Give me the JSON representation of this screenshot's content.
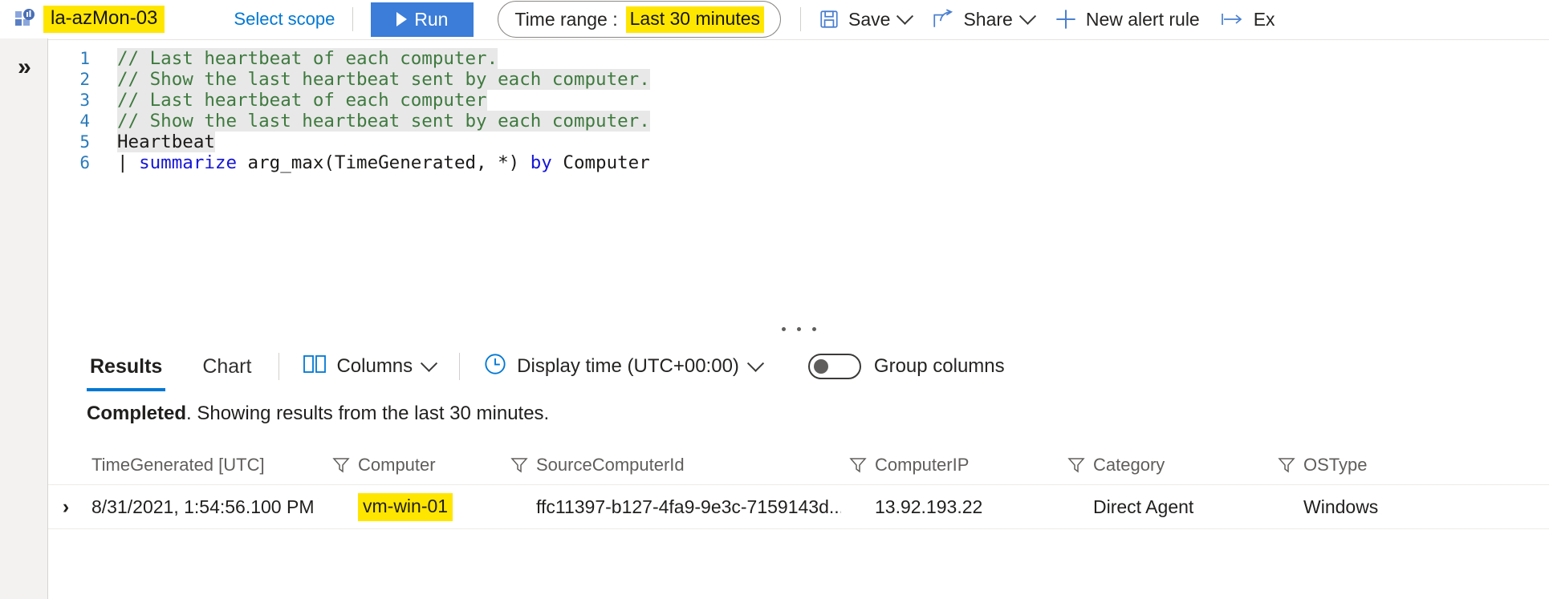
{
  "toolbar": {
    "workspace_icon": "log-analytics-icon",
    "workspace_name": "la-azMon-03",
    "select_scope_label": "Select scope",
    "run_label": "Run",
    "time_range_label": "Time range :",
    "time_range_value": "Last 30 minutes",
    "save_label": "Save",
    "share_label": "Share",
    "new_alert_rule_label": "New alert rule",
    "export_label": "Ex"
  },
  "rail": {
    "expand_label": "»"
  },
  "editor": {
    "lines": [
      {
        "n": "1",
        "type": "comment",
        "text": "// Last heartbeat of each computer."
      },
      {
        "n": "2",
        "type": "comment",
        "text": "// Show the last heartbeat sent by each computer."
      },
      {
        "n": "3",
        "type": "comment",
        "text": "// Last heartbeat of each computer"
      },
      {
        "n": "4",
        "type": "comment",
        "text": "// Show the last heartbeat sent by each computer."
      },
      {
        "n": "5",
        "type": "plain",
        "text": "Heartbeat"
      },
      {
        "n": "6",
        "type": "kql",
        "text": "| summarize arg_max(TimeGenerated, *) by Computer"
      }
    ],
    "line6": {
      "pipe": "|",
      "kw_summarize": "summarize",
      "expr": " arg_max(TimeGenerated, *) ",
      "kw_by": "by",
      "tail": " Computer"
    }
  },
  "results": {
    "tabs": [
      {
        "label": "Results",
        "active": true
      },
      {
        "label": "Chart",
        "active": false
      }
    ],
    "columns_label": "Columns",
    "display_time_label": "Display time (UTC+00:00)",
    "group_columns_label": "Group columns",
    "group_columns_on": false,
    "status_bold": "Completed",
    "status_rest": ". Showing results from the last 30 minutes.",
    "table": {
      "headers": [
        "TimeGenerated [UTC]",
        "Computer",
        "SourceComputerId",
        "ComputerIP",
        "Category",
        "OSType"
      ],
      "rows": [
        {
          "TimeGenerated": "8/31/2021, 1:54:56.100 PM",
          "Computer": "vm-win-01",
          "SourceComputerId": "ffc11397-b127-4fa9-9e3c-7159143d...",
          "ComputerIP": "13.92.193.22",
          "Category": "Direct Agent",
          "OSType": "Windows"
        }
      ]
    }
  },
  "colors": {
    "accent": "#0078d4",
    "run_button": "#3b7dd8",
    "highlight": "#ffe600",
    "comment_green": "#3f7a3f",
    "keyword_blue": "#1616d6"
  }
}
